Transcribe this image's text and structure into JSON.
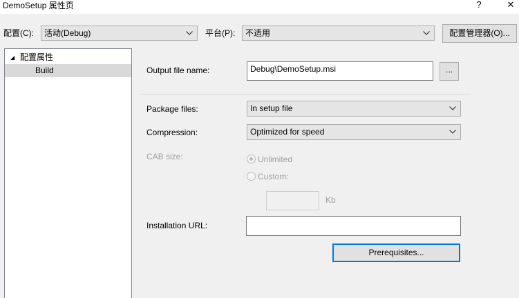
{
  "window": {
    "title": "DemoSetup 属性页",
    "help_glyph": "?",
    "close_glyph": "✕"
  },
  "toolbar": {
    "config_label": "配置(C):",
    "config_value": "活动(Debug)",
    "platform_label": "平台(P):",
    "platform_value": "不适用",
    "config_manager_label": "配置管理器(O)..."
  },
  "tree": {
    "expander_glyph": "◢",
    "root_label": "配置属性",
    "child_label": "Build"
  },
  "form": {
    "output_label": "Output file name:",
    "output_value": "Debug\\DemoSetup.msi",
    "browse_label": "...",
    "package_label": "Package files:",
    "package_value": "In setup file",
    "compression_label": "Compression:",
    "compression_value": "Optimized for speed",
    "cab_label": "CAB size:",
    "unlimited_label": "Unlimited",
    "custom_label": "Custom:",
    "kb_label": "Kb",
    "installation_url_label": "Installation URL:",
    "installation_url_value": "",
    "prerequisites_label": "Prerequisites..."
  },
  "colors": {
    "background": "#f0f0f0",
    "focus_border": "#0078d7",
    "disabled_text": "#a0a0a0"
  }
}
